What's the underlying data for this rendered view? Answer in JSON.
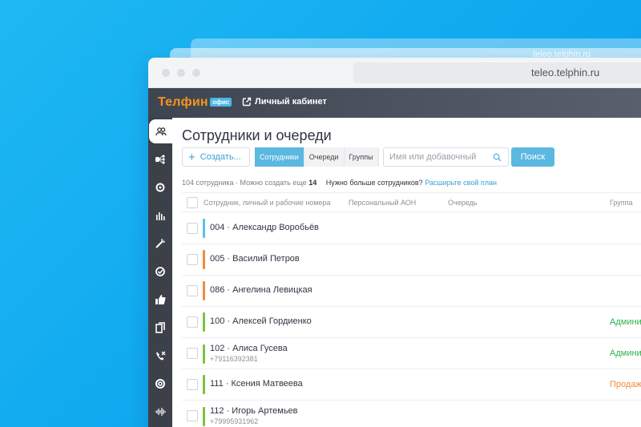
{
  "background": {
    "ghost_url": "teleo.telphin.ru"
  },
  "browser": {
    "url": "teleo.telphin.ru"
  },
  "appbar": {
    "logo_text": "Телфин",
    "logo_badge": "офис",
    "cabinet_label": "Личный кабинет"
  },
  "sidebar": {
    "items": [
      {
        "icon": "people-icon",
        "active": true
      },
      {
        "icon": "routing-icon"
      },
      {
        "icon": "settings-icon"
      },
      {
        "icon": "stats-icon"
      },
      {
        "icon": "magic-icon"
      },
      {
        "icon": "check-circle-icon"
      },
      {
        "icon": "thumbs-up-icon"
      },
      {
        "icon": "documents-icon"
      },
      {
        "icon": "missed-call-icon"
      },
      {
        "icon": "support-icon"
      },
      {
        "icon": "voice-icon"
      }
    ]
  },
  "page": {
    "title": "Сотрудники и очереди",
    "create_label": "Создать...",
    "tabs": [
      {
        "label": "Сотрудники",
        "active": true
      },
      {
        "label": "Очереди"
      },
      {
        "label": "Группы"
      }
    ],
    "search_placeholder": "Имя или добавочный",
    "search_button": "Поиск",
    "info_count": "104 сотрудника · Можно создать еще",
    "info_number": "14",
    "info_need": "Нужно больше сотрудников?",
    "info_link": "Расширьте свой план"
  },
  "table": {
    "columns": [
      "Сотрудник, личный и рабочие номера",
      "Персональный АОН",
      "Очередь",
      "Группа"
    ],
    "rows": [
      {
        "name": "004 · Александр Воробьёв",
        "phone": "",
        "group": "",
        "bar_color": "#5bc0e6",
        "group_color": ""
      },
      {
        "name": "005 · Василий Петров",
        "phone": "",
        "group": "",
        "bar_color": "#f28a3c",
        "group_color": ""
      },
      {
        "name": "086 · Ангелина Левицкая",
        "phone": "",
        "group": "",
        "bar_color": "#f28a3c",
        "group_color": ""
      },
      {
        "name": "100 · Алексей Гордиенко",
        "phone": "",
        "group": "Админи",
        "bar_color": "#7cc243",
        "group_color": "#2fb44a"
      },
      {
        "name": "102 · Алиса Гусева",
        "phone": "+79116392381",
        "group": "Админи",
        "bar_color": "#7cc243",
        "group_color": "#2fb44a"
      },
      {
        "name": "111 · Ксения Матвеева",
        "phone": "",
        "group": "Продаж",
        "bar_color": "#7cc243",
        "group_color": "#f28a3c"
      },
      {
        "name": "112 · Игорь Артемьев",
        "phone": "+79995931962",
        "group": "",
        "bar_color": "#7cc243",
        "group_color": ""
      }
    ]
  }
}
